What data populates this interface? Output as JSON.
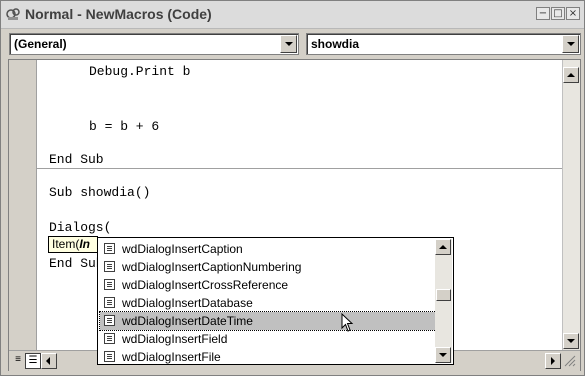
{
  "window": {
    "title": "Normal - NewMacros (Code)",
    "minimize_glyph": "−",
    "maximize_glyph": "□",
    "close_glyph": "×"
  },
  "object_dropdown": {
    "value": "(General)"
  },
  "procedure_dropdown": {
    "value": "showdia"
  },
  "code_lines": [
    "Debug.Print b",
    "b = b + 6",
    "End Sub",
    "Sub showdia()",
    "Dialogs(",
    "End Sub"
  ],
  "tooltip": {
    "prefix": "Item(",
    "bold": "In"
  },
  "autocomplete": {
    "items": [
      "wdDialogInsertCaption",
      "wdDialogInsertCaptionNumbering",
      "wdDialogInsertCrossReference",
      "wdDialogInsertDatabase",
      "wdDialogInsertDateTime",
      "wdDialogInsertField",
      "wdDialogInsertFile"
    ],
    "selected_index": 4
  },
  "view_buttons": {
    "procedure_view_glyph": "≡",
    "module_view_glyph": "☰"
  },
  "icons": [
    "vba-module-icon",
    "list-item-icon",
    "mouse-pointer-icon"
  ]
}
